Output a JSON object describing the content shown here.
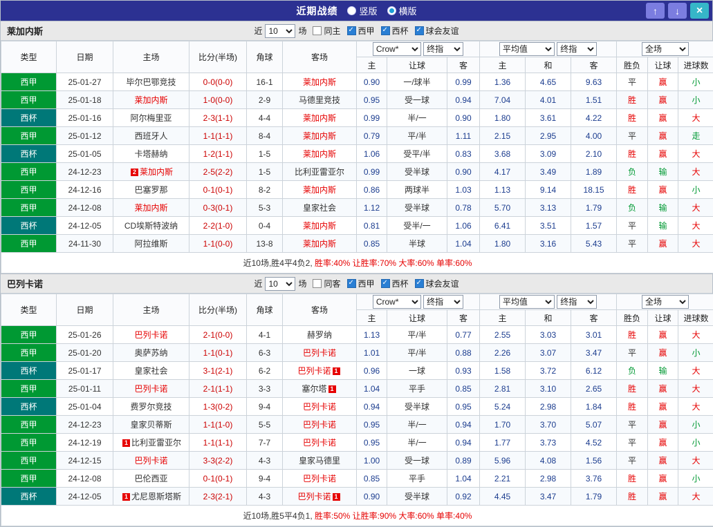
{
  "titlebar": {
    "title": "近期战绩",
    "vertical_label": "竖版",
    "horizontal_label": "横版",
    "vertical_selected": false,
    "horizontal_selected": true,
    "up_icon": "↑",
    "down_icon": "↓",
    "close_icon": "×"
  },
  "filters": {
    "recent_label": "近",
    "count_value": "10",
    "games_label": "场",
    "same_checked": false,
    "league_options": [
      "西甲",
      "西杯",
      "球会友谊"
    ],
    "league_checked": [
      true,
      true,
      true
    ]
  },
  "dropdowns": {
    "asia_source": "Crow*",
    "asia_time": "终指",
    "eu_source": "平均值",
    "eu_time": "终指",
    "scope": "全场"
  },
  "table_header": {
    "type": "类型",
    "date": "日期",
    "home": "主场",
    "score": "比分(半场)",
    "corner": "角球",
    "away": "客场",
    "ah_home": "主",
    "ah_line": "让球",
    "ah_away": "客",
    "eu_home": "主",
    "eu_draw": "和",
    "eu_away": "客",
    "result": "胜负",
    "ah_result": "让球",
    "goals": "进球数"
  },
  "colors": {
    "league": {
      "西甲": "#009933",
      "西杯": "#007878"
    },
    "result": {
      "胜": "#e60000",
      "平": "#333333",
      "负": "#009933",
      "赢": "#e60000",
      "输": "#009933",
      "大": "#e60000",
      "小": "#009933",
      "走": "#009933"
    },
    "focus_team": "#e60000",
    "score": "#cc0000",
    "odds": "#1c3d8f",
    "summary_highlight": "#e60000"
  },
  "sections": [
    {
      "team": "莱加内斯",
      "same_filter_label": "同主",
      "rows": [
        {
          "league": "西甲",
          "date": "25-01-27",
          "home": "毕尔巴鄂竞技",
          "home_focus": false,
          "score": "0-0(0-0)",
          "corner": "16-1",
          "away": "莱加内斯",
          "away_focus": true,
          "ah": [
            "0.90",
            "一/球半",
            "0.99"
          ],
          "eu": [
            "1.36",
            "4.65",
            "9.63"
          ],
          "result": "平",
          "ah_result": "赢",
          "goals_result": "小"
        },
        {
          "league": "西甲",
          "date": "25-01-18",
          "home": "莱加内斯",
          "home_focus": true,
          "score": "1-0(0-0)",
          "corner": "2-9",
          "away": "马德里竞技",
          "away_focus": false,
          "ah": [
            "0.95",
            "受一球",
            "0.94"
          ],
          "eu": [
            "7.04",
            "4.01",
            "1.51"
          ],
          "result": "胜",
          "ah_result": "赢",
          "goals_result": "小"
        },
        {
          "league": "西杯",
          "date": "25-01-16",
          "home": "阿尔梅里亚",
          "home_focus": false,
          "score": "2-3(1-1)",
          "corner": "4-4",
          "away": "莱加内斯",
          "away_focus": true,
          "ah": [
            "0.99",
            "半/一",
            "0.90"
          ],
          "eu": [
            "1.80",
            "3.61",
            "4.22"
          ],
          "result": "胜",
          "ah_result": "赢",
          "goals_result": "大"
        },
        {
          "league": "西甲",
          "date": "25-01-12",
          "home": "西班牙人",
          "home_focus": false,
          "score": "1-1(1-1)",
          "corner": "8-4",
          "away": "莱加内斯",
          "away_focus": true,
          "ah": [
            "0.79",
            "平/半",
            "1.11"
          ],
          "eu": [
            "2.15",
            "2.95",
            "4.00"
          ],
          "result": "平",
          "ah_result": "赢",
          "goals_result": "走"
        },
        {
          "league": "西杯",
          "date": "25-01-05",
          "home": "卡塔赫纳",
          "home_focus": false,
          "score": "1-2(1-1)",
          "corner": "1-5",
          "away": "莱加内斯",
          "away_focus": true,
          "ah": [
            "1.06",
            "受平/半",
            "0.83"
          ],
          "eu": [
            "3.68",
            "3.09",
            "2.10"
          ],
          "result": "胜",
          "ah_result": "赢",
          "goals_result": "大"
        },
        {
          "league": "西甲",
          "date": "24-12-23",
          "home": "莱加内斯",
          "home_focus": true,
          "home_badge": "2",
          "score": "2-5(2-2)",
          "corner": "1-5",
          "away": "比利亚雷亚尔",
          "away_focus": false,
          "ah": [
            "0.99",
            "受半球",
            "0.90"
          ],
          "eu": [
            "4.17",
            "3.49",
            "1.89"
          ],
          "result": "负",
          "ah_result": "输",
          "goals_result": "大"
        },
        {
          "league": "西甲",
          "date": "24-12-16",
          "home": "巴塞罗那",
          "home_focus": false,
          "score": "0-1(0-1)",
          "corner": "8-2",
          "away": "莱加内斯",
          "away_focus": true,
          "ah": [
            "0.86",
            "两球半",
            "1.03"
          ],
          "eu": [
            "1.13",
            "9.14",
            "18.15"
          ],
          "result": "胜",
          "ah_result": "赢",
          "goals_result": "小"
        },
        {
          "league": "西甲",
          "date": "24-12-08",
          "home": "莱加内斯",
          "home_focus": true,
          "score": "0-3(0-1)",
          "corner": "5-3",
          "away": "皇家社会",
          "away_focus": false,
          "ah": [
            "1.12",
            "受半球",
            "0.78"
          ],
          "eu": [
            "5.70",
            "3.13",
            "1.79"
          ],
          "result": "负",
          "ah_result": "输",
          "goals_result": "大"
        },
        {
          "league": "西杯",
          "date": "24-12-05",
          "home": "CD埃斯特波纳",
          "home_focus": false,
          "score": "2-2(1-0)",
          "corner": "0-4",
          "away": "莱加内斯",
          "away_focus": true,
          "ah": [
            "0.81",
            "受半/一",
            "1.06"
          ],
          "eu": [
            "6.41",
            "3.51",
            "1.57"
          ],
          "result": "平",
          "ah_result": "输",
          "goals_result": "大"
        },
        {
          "league": "西甲",
          "date": "24-11-30",
          "home": "阿拉维斯",
          "home_focus": false,
          "score": "1-1(0-0)",
          "corner": "13-8",
          "away": "莱加内斯",
          "away_focus": true,
          "ah": [
            "0.85",
            "半球",
            "1.04"
          ],
          "eu": [
            "1.80",
            "3.16",
            "5.43"
          ],
          "result": "平",
          "ah_result": "赢",
          "goals_result": "大"
        }
      ],
      "summary": [
        {
          "text": "近10场,胜4平4负2, ",
          "highlight": false
        },
        {
          "text": "胜率:40% 让胜率:70% 大率:60% 单率:60%",
          "highlight": true
        }
      ]
    },
    {
      "team": "巴列卡诺",
      "same_filter_label": "同客",
      "rows": [
        {
          "league": "西甲",
          "date": "25-01-26",
          "home": "巴列卡诺",
          "home_focus": true,
          "score": "2-1(0-0)",
          "corner": "4-1",
          "away": "赫罗纳",
          "away_focus": false,
          "ah": [
            "1.13",
            "平/半",
            "0.77"
          ],
          "eu": [
            "2.55",
            "3.03",
            "3.01"
          ],
          "result": "胜",
          "ah_result": "赢",
          "goals_result": "大"
        },
        {
          "league": "西甲",
          "date": "25-01-20",
          "home": "奥萨苏纳",
          "home_focus": false,
          "score": "1-1(0-1)",
          "corner": "6-3",
          "away": "巴列卡诺",
          "away_focus": true,
          "ah": [
            "1.01",
            "平/半",
            "0.88"
          ],
          "eu": [
            "2.26",
            "3.07",
            "3.47"
          ],
          "result": "平",
          "ah_result": "赢",
          "goals_result": "小"
        },
        {
          "league": "西杯",
          "date": "25-01-17",
          "home": "皇家社会",
          "home_focus": false,
          "score": "3-1(2-1)",
          "corner": "6-2",
          "away": "巴列卡诺",
          "away_focus": true,
          "away_badge": "1",
          "ah": [
            "0.96",
            "一球",
            "0.93"
          ],
          "eu": [
            "1.58",
            "3.72",
            "6.12"
          ],
          "result": "负",
          "ah_result": "输",
          "goals_result": "大"
        },
        {
          "league": "西甲",
          "date": "25-01-11",
          "home": "巴列卡诺",
          "home_focus": true,
          "score": "2-1(1-1)",
          "corner": "3-3",
          "away": "塞尔塔",
          "away_focus": false,
          "away_badge": "1",
          "ah": [
            "1.04",
            "平手",
            "0.85"
          ],
          "eu": [
            "2.81",
            "3.10",
            "2.65"
          ],
          "result": "胜",
          "ah_result": "赢",
          "goals_result": "大"
        },
        {
          "league": "西杯",
          "date": "25-01-04",
          "home": "费罗尔竞技",
          "home_focus": false,
          "score": "1-3(0-2)",
          "corner": "9-4",
          "away": "巴列卡诺",
          "away_focus": true,
          "ah": [
            "0.94",
            "受半球",
            "0.95"
          ],
          "eu": [
            "5.24",
            "2.98",
            "1.84"
          ],
          "result": "胜",
          "ah_result": "赢",
          "goals_result": "大"
        },
        {
          "league": "西甲",
          "date": "24-12-23",
          "home": "皇家贝蒂斯",
          "home_focus": false,
          "score": "1-1(1-0)",
          "corner": "5-5",
          "away": "巴列卡诺",
          "away_focus": true,
          "ah": [
            "0.95",
            "半/一",
            "0.94"
          ],
          "eu": [
            "1.70",
            "3.70",
            "5.07"
          ],
          "result": "平",
          "ah_result": "赢",
          "goals_result": "小"
        },
        {
          "league": "西甲",
          "date": "24-12-19",
          "home": "比利亚雷亚尔",
          "home_focus": false,
          "home_badge": "1",
          "score": "1-1(1-1)",
          "corner": "7-7",
          "away": "巴列卡诺",
          "away_focus": true,
          "ah": [
            "0.95",
            "半/一",
            "0.94"
          ],
          "eu": [
            "1.77",
            "3.73",
            "4.52"
          ],
          "result": "平",
          "ah_result": "赢",
          "goals_result": "小"
        },
        {
          "league": "西甲",
          "date": "24-12-15",
          "home": "巴列卡诺",
          "home_focus": true,
          "score": "3-3(2-2)",
          "corner": "4-3",
          "away": "皇家马德里",
          "away_focus": false,
          "ah": [
            "1.00",
            "受一球",
            "0.89"
          ],
          "eu": [
            "5.96",
            "4.08",
            "1.56"
          ],
          "result": "平",
          "ah_result": "赢",
          "goals_result": "大"
        },
        {
          "league": "西甲",
          "date": "24-12-08",
          "home": "巴伦西亚",
          "home_focus": false,
          "score": "0-1(0-1)",
          "corner": "9-4",
          "away": "巴列卡诺",
          "away_focus": true,
          "ah": [
            "0.85",
            "平手",
            "1.04"
          ],
          "eu": [
            "2.21",
            "2.98",
            "3.76"
          ],
          "result": "胜",
          "ah_result": "赢",
          "goals_result": "小"
        },
        {
          "league": "西杯",
          "date": "24-12-05",
          "home": "尤尼恩斯塔斯",
          "home_focus": false,
          "home_badge": "1",
          "score": "2-3(2-1)",
          "corner": "4-3",
          "away": "巴列卡诺",
          "away_focus": true,
          "away_badge": "1",
          "ah": [
            "0.90",
            "受半球",
            "0.92"
          ],
          "eu": [
            "4.45",
            "3.47",
            "1.79"
          ],
          "result": "胜",
          "ah_result": "赢",
          "goals_result": "大"
        }
      ],
      "summary": [
        {
          "text": "近10场,胜5平4负1, ",
          "highlight": false
        },
        {
          "text": "胜率:50% 让胜率:90% 大率:60% 单率:40%",
          "highlight": true
        }
      ]
    }
  ]
}
